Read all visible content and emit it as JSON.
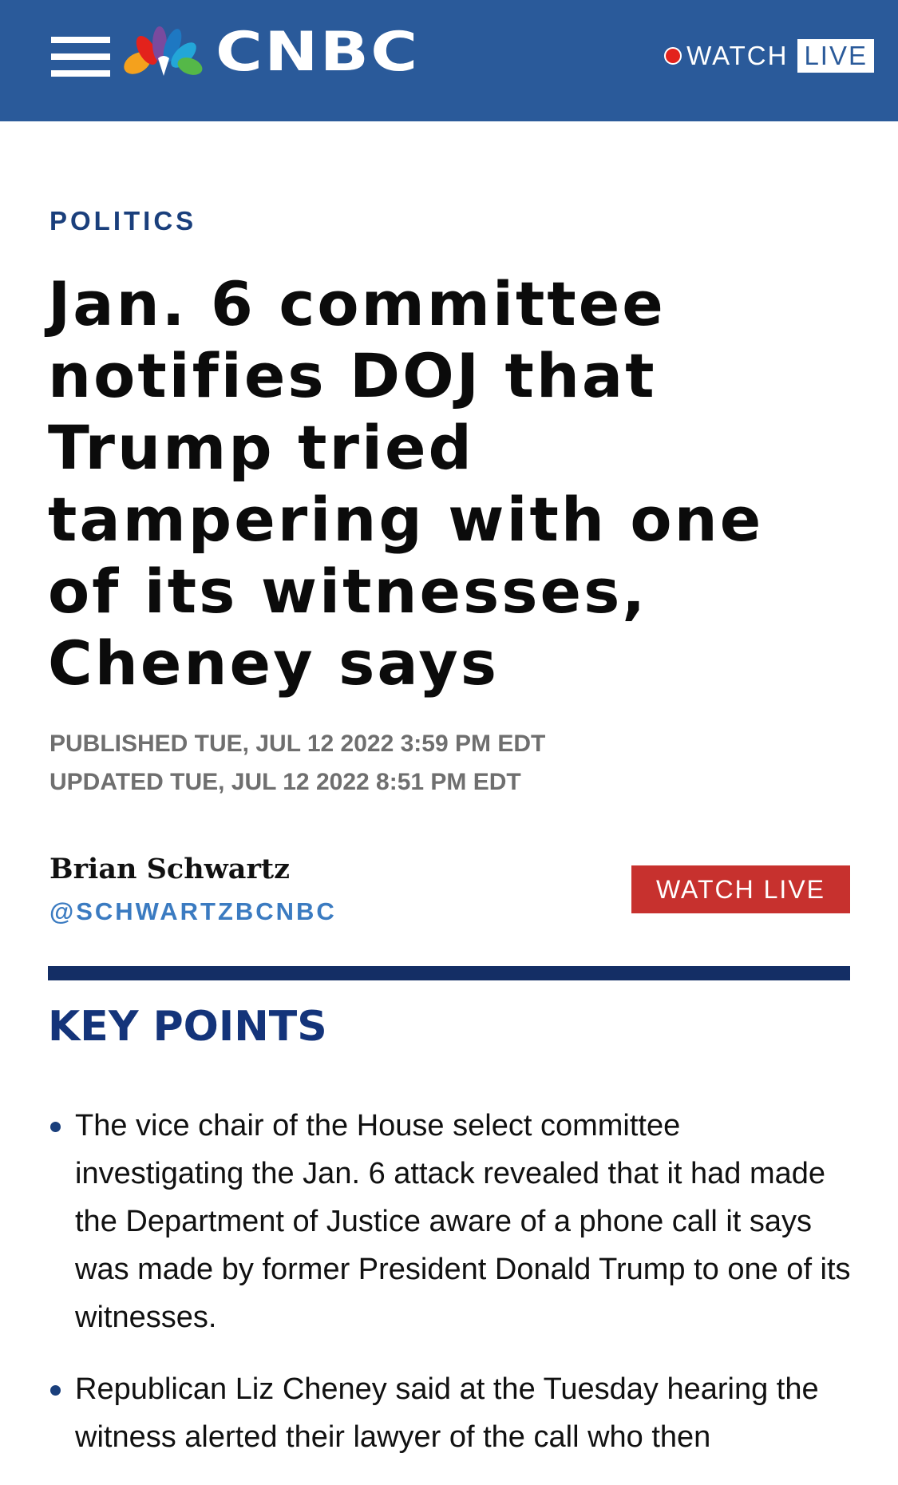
{
  "header": {
    "brand": "CNBC",
    "watch_label": "WATCH",
    "live_label": "LIVE"
  },
  "article": {
    "section": "POLITICS",
    "headline": "Jan. 6 committee notifies DOJ that Trump tried tampering with one of its witnesses, Cheney says",
    "published": "PUBLISHED TUE, JUL 12 2022 3:59 PM EDT",
    "updated": "UPDATED TUE, JUL 12 2022 8:51 PM EDT",
    "author": "Brian Schwartz",
    "handle": "@SCHWARTZBCNBC",
    "watch_live_button": "WATCH LIVE"
  },
  "key_points": {
    "heading": "KEY POINTS",
    "items": [
      "The vice chair of the House select committee investigating the Jan. 6 attack revealed that it had made the Department of Justice aware of a phone call it says was made by former President Donald Trump to one of its witnesses.",
      "Republican Liz Cheney said at the Tuesday hearing the witness alerted their lawyer of the call who then"
    ]
  },
  "colors": {
    "header_blue": "#2a5a9a",
    "section_blue": "#1a3f7c",
    "handle_blue": "#3b7bc1",
    "live_red": "#c7312e",
    "divider_navy": "#142e65"
  },
  "icons": [
    "hamburger-menu-icon",
    "peacock-logo-icon",
    "live-dot-icon"
  ]
}
